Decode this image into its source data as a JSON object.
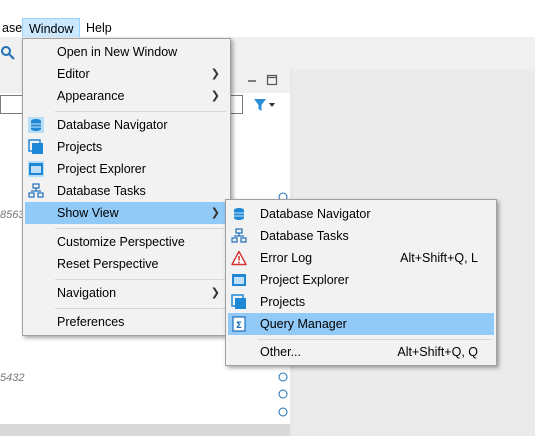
{
  "menubar": {
    "item_left": "ase",
    "item_window": "Window",
    "item_help": "Help"
  },
  "background": {
    "value1": "8563",
    "value2": "5432"
  },
  "window_menu": {
    "items": [
      {
        "label": "Open in New Window"
      },
      {
        "label": "Editor"
      },
      {
        "label": "Appearance"
      },
      {
        "label": "Database Navigator"
      },
      {
        "label": "Projects"
      },
      {
        "label": "Project Explorer"
      },
      {
        "label": "Database Tasks"
      },
      {
        "label": "Show View"
      },
      {
        "label": "Customize Perspective"
      },
      {
        "label": "Reset Perspective"
      },
      {
        "label": "Navigation"
      },
      {
        "label": "Preferences"
      }
    ]
  },
  "show_view_menu": {
    "items": [
      {
        "label": "Database Navigator",
        "shortcut": ""
      },
      {
        "label": "Database Tasks",
        "shortcut": ""
      },
      {
        "label": "Error Log",
        "shortcut": "Alt+Shift+Q, L"
      },
      {
        "label": "Project Explorer",
        "shortcut": ""
      },
      {
        "label": "Projects",
        "shortcut": ""
      },
      {
        "label": "Query Manager",
        "shortcut": ""
      },
      {
        "label": "Other...",
        "shortcut": "Alt+Shift+Q, Q"
      }
    ]
  },
  "colors": {
    "highlight": "#91c9f7",
    "accent": "#1e88d6",
    "error": "#d32f2f"
  }
}
